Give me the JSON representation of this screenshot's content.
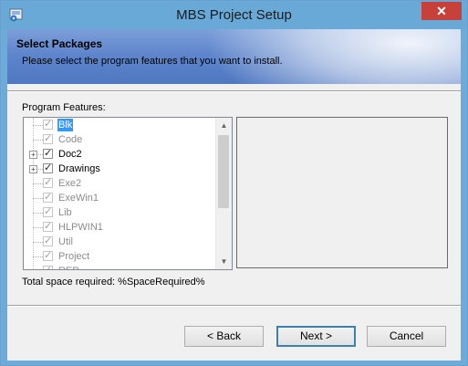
{
  "window": {
    "title": "MBS Project Setup",
    "close_glyph": "✕"
  },
  "banner": {
    "title": "Select Packages",
    "subtitle": "Please select the program features that you want to install."
  },
  "features": {
    "label": "Program Features:",
    "items": [
      {
        "label": "Blk",
        "checked": true,
        "dim": true,
        "expandable": false,
        "selected": true
      },
      {
        "label": "Code",
        "checked": true,
        "dim": true,
        "expandable": false,
        "selected": false
      },
      {
        "label": "Doc2",
        "checked": true,
        "dim": false,
        "expandable": true,
        "selected": false
      },
      {
        "label": "Drawings",
        "checked": true,
        "dim": false,
        "expandable": true,
        "selected": false
      },
      {
        "label": "Exe2",
        "checked": true,
        "dim": true,
        "expandable": false,
        "selected": false
      },
      {
        "label": "ExeWin1",
        "checked": true,
        "dim": true,
        "expandable": false,
        "selected": false
      },
      {
        "label": "Lib",
        "checked": true,
        "dim": true,
        "expandable": false,
        "selected": false
      },
      {
        "label": "HLPWIN1",
        "checked": true,
        "dim": true,
        "expandable": false,
        "selected": false
      },
      {
        "label": "Util",
        "checked": true,
        "dim": true,
        "expandable": false,
        "selected": false
      },
      {
        "label": "Project",
        "checked": true,
        "dim": true,
        "expandable": false,
        "selected": false
      },
      {
        "label": "REP",
        "checked": true,
        "dim": true,
        "expandable": false,
        "selected": false
      }
    ],
    "scroll_up_glyph": "▲",
    "scroll_down_glyph": "▼",
    "check_glyph": "✓",
    "expand_glyph": "+"
  },
  "space_required": "Total space required: %SpaceRequired%",
  "buttons": {
    "back": "< Back",
    "next": "Next >",
    "cancel": "Cancel"
  },
  "colors": {
    "selection": "#3399ff",
    "title_bar": "#69a9d7",
    "close": "#c7403a"
  }
}
